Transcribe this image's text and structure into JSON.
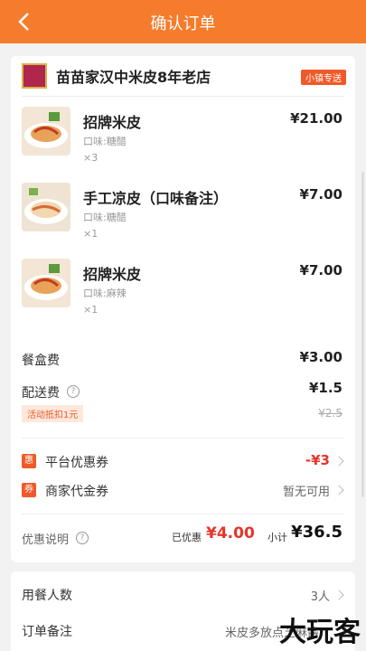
{
  "header": {
    "title": "确认订单",
    "back_icon": "chevron-left-icon"
  },
  "shop": {
    "name": "苗苗家汉中米皮8年老店",
    "tag": "小镇专送"
  },
  "items": [
    {
      "name": "招牌米皮",
      "flavor": "口味:糖醋",
      "qty": "×3",
      "price": "¥21.00"
    },
    {
      "name": "手工凉皮（口味备注）",
      "flavor": "口味:糖醋",
      "qty": "×1",
      "price": "¥7.00"
    },
    {
      "name": "招牌米皮",
      "flavor": "口味:麻辣",
      "qty": "×1",
      "price": "¥7.00"
    }
  ],
  "fees": {
    "box_label": "餐盒费",
    "box_value": "¥3.00",
    "delivery_label": "配送费",
    "delivery_value": "¥1.5",
    "delivery_promo": "活动抵扣1元",
    "delivery_original": "¥2.5",
    "help_glyph": "?"
  },
  "coupons": {
    "platform_badge": "惠",
    "platform_label": "平台优惠券",
    "platform_value": "-¥3",
    "merchant_badge": "券",
    "merchant_label": "商家代金券",
    "merchant_value": "暂无可用"
  },
  "summary": {
    "label": "优惠说明",
    "discount_label": "已优惠",
    "discount_value": "¥4.00",
    "subtotal_label": "小计",
    "subtotal_value": "¥36.5"
  },
  "extra": {
    "diners_label": "用餐人数",
    "diners_value": "3人",
    "remark_label": "订单备注",
    "remark_value": "米皮多放点芝麻酱"
  },
  "watermark": "大玩客",
  "colors": {
    "accent": "#f57c2c",
    "discount": "#e5352b"
  }
}
